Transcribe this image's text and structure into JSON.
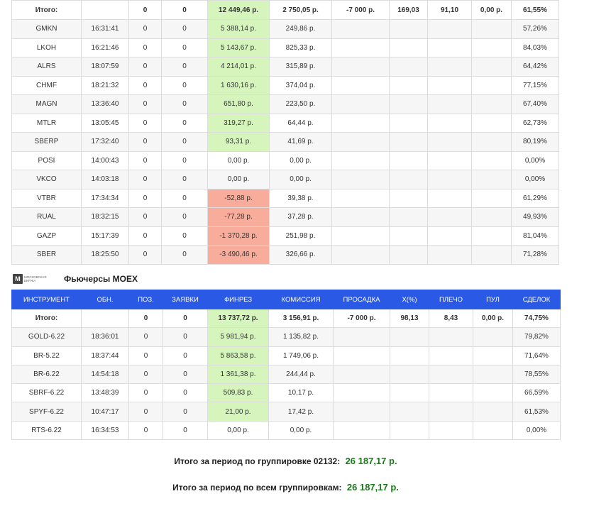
{
  "stocks": {
    "total": {
      "label": "Итого:",
      "time": "",
      "pos": "0",
      "orders": "0",
      "finres": "12 449,46 р.",
      "finres_class": "gain",
      "commission": "2 750,05 р.",
      "drawdown": "-7 000 р.",
      "x": "169,03",
      "leverage": "91,10",
      "pul": "0,00 р.",
      "deals": "61,55%"
    },
    "rows": [
      {
        "instrument": "GMKN",
        "time": "16:31:41",
        "pos": "0",
        "orders": "0",
        "finres": "5 388,14 р.",
        "finres_class": "gain",
        "commission": "249,86 р.",
        "deals": "57,26%"
      },
      {
        "instrument": "LKOH",
        "time": "16:21:46",
        "pos": "0",
        "orders": "0",
        "finres": "5 143,67 р.",
        "finres_class": "gain",
        "commission": "825,33 р.",
        "deals": "84,03%"
      },
      {
        "instrument": "ALRS",
        "time": "18:07:59",
        "pos": "0",
        "orders": "0",
        "finres": "4 214,01 р.",
        "finres_class": "gain",
        "commission": "315,89 р.",
        "deals": "64,42%"
      },
      {
        "instrument": "CHMF",
        "time": "18:21:32",
        "pos": "0",
        "orders": "0",
        "finres": "1 630,16 р.",
        "finres_class": "gain",
        "commission": "374,04 р.",
        "deals": "77,15%"
      },
      {
        "instrument": "MAGN",
        "time": "13:36:40",
        "pos": "0",
        "orders": "0",
        "finres": "651,80 р.",
        "finres_class": "gain",
        "commission": "223,50 р.",
        "deals": "67,40%"
      },
      {
        "instrument": "MTLR",
        "time": "13:05:45",
        "pos": "0",
        "orders": "0",
        "finres": "319,27 р.",
        "finres_class": "gain",
        "commission": "64,44 р.",
        "deals": "62,73%"
      },
      {
        "instrument": "SBERP",
        "time": "17:32:40",
        "pos": "0",
        "orders": "0",
        "finres": "93,31 р.",
        "finres_class": "gain",
        "commission": "41,69 р.",
        "deals": "80,19%"
      },
      {
        "instrument": "POSI",
        "time": "14:00:43",
        "pos": "0",
        "orders": "0",
        "finres": "0,00 р.",
        "finres_class": "",
        "commission": "0,00 р.",
        "deals": "0,00%"
      },
      {
        "instrument": "VKCO",
        "time": "14:03:18",
        "pos": "0",
        "orders": "0",
        "finres": "0,00 р.",
        "finres_class": "",
        "commission": "0,00 р.",
        "deals": "0,00%"
      },
      {
        "instrument": "VTBR",
        "time": "17:34:34",
        "pos": "0",
        "orders": "0",
        "finres": "-52,88 р.",
        "finres_class": "loss",
        "commission": "39,38 р.",
        "deals": "61,29%"
      },
      {
        "instrument": "RUAL",
        "time": "18:32:15",
        "pos": "0",
        "orders": "0",
        "finres": "-77,28 р.",
        "finres_class": "loss",
        "commission": "37,28 р.",
        "deals": "49,93%"
      },
      {
        "instrument": "GAZP",
        "time": "15:17:39",
        "pos": "0",
        "orders": "0",
        "finres": "-1 370,28 р.",
        "finres_class": "loss",
        "commission": "251,98 р.",
        "deals": "81,04%"
      },
      {
        "instrument": "SBER",
        "time": "18:25:50",
        "pos": "0",
        "orders": "0",
        "finres": "-3 490,46 р.",
        "finres_class": "loss",
        "commission": "326,66 р.",
        "deals": "71,28%"
      }
    ]
  },
  "futures_section": {
    "logo_mark": "М",
    "logo_text": "Московская биржа",
    "title": "Фьючерсы MOEX"
  },
  "futures": {
    "headers": [
      "ИНСТРУМЕНТ",
      "ОБН.",
      "ПОЗ.",
      "ЗАЯВКИ",
      "ФИНРЕЗ",
      "КОМИССИЯ",
      "ПРОСАДКА",
      "X(%)",
      "ПЛЕЧО",
      "ПУЛ",
      "СДЕЛОК"
    ],
    "total": {
      "label": "Итого:",
      "time": "",
      "pos": "0",
      "orders": "0",
      "finres": "13 737,72 р.",
      "finres_class": "gain",
      "commission": "3 156,91 р.",
      "drawdown": "-7 000 р.",
      "x": "98,13",
      "leverage": "8,43",
      "pul": "0,00 р.",
      "deals": "74,75%"
    },
    "rows": [
      {
        "instrument": "GOLD-6.22",
        "time": "18:36:01",
        "pos": "0",
        "orders": "0",
        "finres": "5 981,94 р.",
        "finres_class": "gain",
        "commission": "1 135,82 р.",
        "deals": "79,82%"
      },
      {
        "instrument": "BR-5.22",
        "time": "18:37:44",
        "pos": "0",
        "orders": "0",
        "finres": "5 863,58 р.",
        "finres_class": "gain",
        "commission": "1 749,06 р.",
        "deals": "71,64%"
      },
      {
        "instrument": "BR-6.22",
        "time": "14:54:18",
        "pos": "0",
        "orders": "0",
        "finres": "1 361,38 р.",
        "finres_class": "gain",
        "commission": "244,44 р.",
        "deals": "78,55%"
      },
      {
        "instrument": "SBRF-6.22",
        "time": "13:48:39",
        "pos": "0",
        "orders": "0",
        "finres": "509,83 р.",
        "finres_class": "gain",
        "commission": "10,17 р.",
        "deals": "66,59%"
      },
      {
        "instrument": "SPYF-6.22",
        "time": "10:47:17",
        "pos": "0",
        "orders": "0",
        "finres": "21,00 р.",
        "finres_class": "gain",
        "commission": "17,42 р.",
        "deals": "61,53%"
      },
      {
        "instrument": "RTS-6.22",
        "time": "16:34:53",
        "pos": "0",
        "orders": "0",
        "finres": "0,00 р.",
        "finres_class": "",
        "commission": "0,00 р.",
        "deals": "0,00%"
      }
    ]
  },
  "summary": {
    "group_label": "Итого за период по группировке 02132:",
    "group_amount": "26 187,17 р.",
    "all_label": "Итого за период по всем группировкам:",
    "all_amount": "26 187,17 р."
  },
  "colors": {
    "header_blue": "#2a59e6",
    "gain": "#d6f5bd",
    "loss": "#f8ad9c",
    "total_green": "#1a7a1a"
  }
}
